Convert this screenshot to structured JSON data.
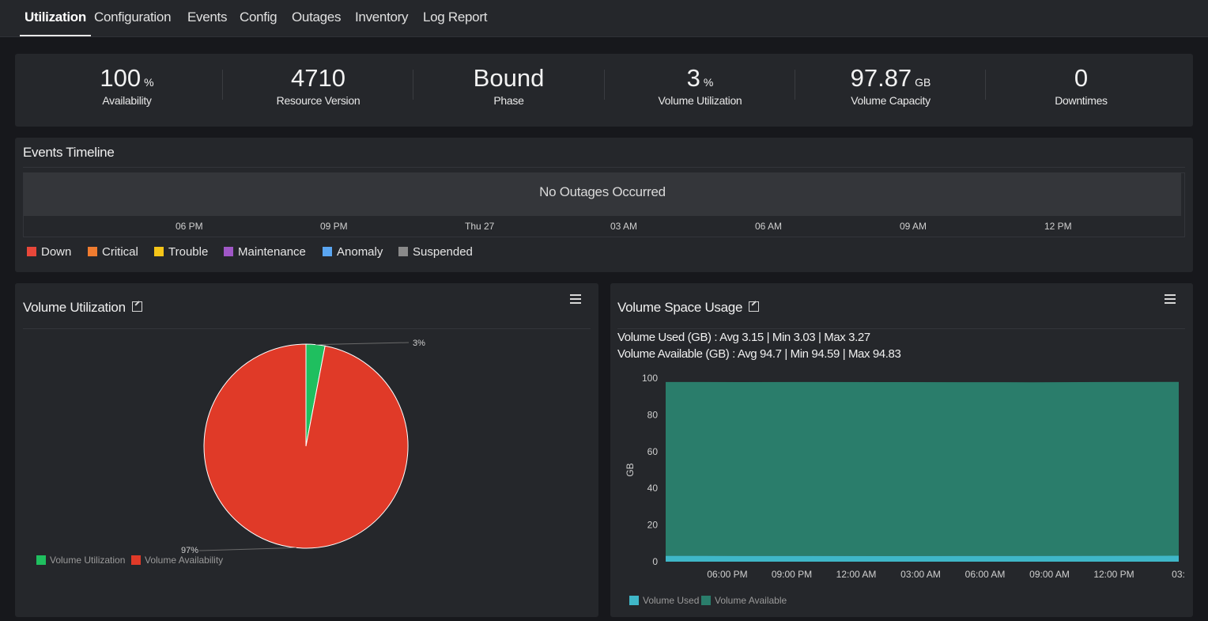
{
  "tabs": [
    {
      "label": "Utilization",
      "active": true
    },
    {
      "label": "Configuration"
    },
    {
      "label": "Events"
    },
    {
      "label": "Config"
    },
    {
      "label": "Outages"
    },
    {
      "label": "Inventory"
    },
    {
      "label": "Log Report"
    }
  ],
  "stats": [
    {
      "value": "100",
      "unit": "%",
      "label": "Availability"
    },
    {
      "value": "4710",
      "unit": "",
      "label": "Resource Version"
    },
    {
      "value": "Bound",
      "unit": "",
      "label": "Phase"
    },
    {
      "value": "3",
      "unit": "%",
      "label": "Volume Utilization"
    },
    {
      "value": "97.87",
      "unit": "GB",
      "label": "Volume Capacity"
    },
    {
      "value": "0",
      "unit": "",
      "label": "Downtimes"
    }
  ],
  "events_timeline": {
    "title": "Events Timeline",
    "message": "No Outages Occurred",
    "ticks": [
      "06 PM",
      "09 PM",
      "Thu 27",
      "03 AM",
      "06 AM",
      "09 AM",
      "12 PM"
    ],
    "legend": [
      {
        "label": "Down",
        "color": "#e8473a"
      },
      {
        "label": "Critical",
        "color": "#f07c30"
      },
      {
        "label": "Trouble",
        "color": "#f5c518"
      },
      {
        "label": "Maintenance",
        "color": "#a057c7"
      },
      {
        "label": "Anomaly",
        "color": "#5aa6f2"
      },
      {
        "label": "Suspended",
        "color": "#8a8a8a"
      }
    ]
  },
  "volume_utilization": {
    "title": "Volume Utilization",
    "menu_icon": "hamburger-menu-icon",
    "chart_data": {
      "type": "pie",
      "slices": [
        {
          "name": "Volume Utilization",
          "value": 3,
          "label": "3%",
          "color": "#1fbf5f"
        },
        {
          "name": "Volume Availability",
          "value": 97,
          "label": "97%",
          "color": "#e03a28"
        }
      ]
    }
  },
  "volume_space": {
    "title": "Volume Space Usage",
    "menu_icon": "hamburger-menu-icon",
    "used_stats": "Volume Used (GB) :  Avg 3.15  |  Min 3.03  |  Max 3.27",
    "avail_stats": "Volume Available (GB) :  Avg 94.7  |  Min 94.59  |  Max 94.83",
    "chart_data": {
      "type": "area",
      "stacked": true,
      "ylabel": "GB",
      "ylim": [
        0,
        100
      ],
      "yticks": [
        "100",
        "80",
        "60",
        "40",
        "20",
        "0"
      ],
      "x": [
        "06:00 PM",
        "09:00 PM",
        "12:00 AM",
        "03:00 AM",
        "06:00 AM",
        "09:00 AM",
        "12:00 PM",
        "03:"
      ],
      "series": [
        {
          "name": "Volume Used",
          "color": "#3fb7c8",
          "values": [
            3.2,
            3.15,
            3.1,
            3.05,
            3.1,
            3.15,
            3.2,
            3.25
          ]
        },
        {
          "name": "Volume Available",
          "color": "#2a7d6b",
          "values": [
            94.7,
            94.7,
            94.8,
            94.8,
            94.7,
            94.6,
            94.7,
            94.7
          ]
        }
      ]
    }
  }
}
